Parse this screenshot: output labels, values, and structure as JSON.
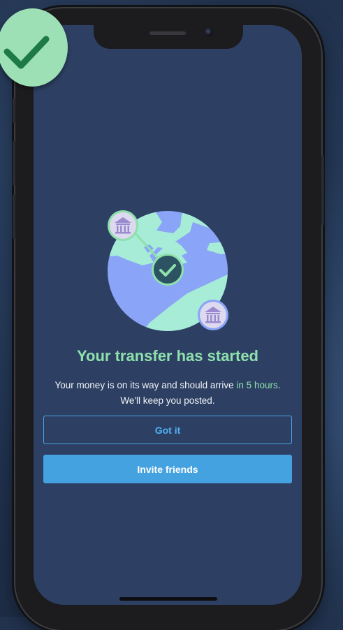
{
  "transfer_screen": {
    "title": "Your transfer has started",
    "message_prefix": "Your money is on its way and should arrive",
    "message_highlight": "in 5 hours",
    "message_suffix": ".",
    "message_line2": "We'll keep you posted."
  },
  "buttons": {
    "got_it_label": "Got it",
    "invite_friends_label": "Invite friends"
  },
  "icons": {
    "success_badge": "checkmark-icon",
    "illustration": "globe-illustration",
    "source_bank": "bank-icon",
    "destination_bank": "bank-icon",
    "transit_check": "checkmark-icon"
  },
  "colors": {
    "screen_background": "#2d4063",
    "accent_green": "#8fe0ad",
    "accent_blue": "#45a2e0",
    "badge_green": "#9de0b5",
    "check_dark_green": "#1e7a45"
  }
}
